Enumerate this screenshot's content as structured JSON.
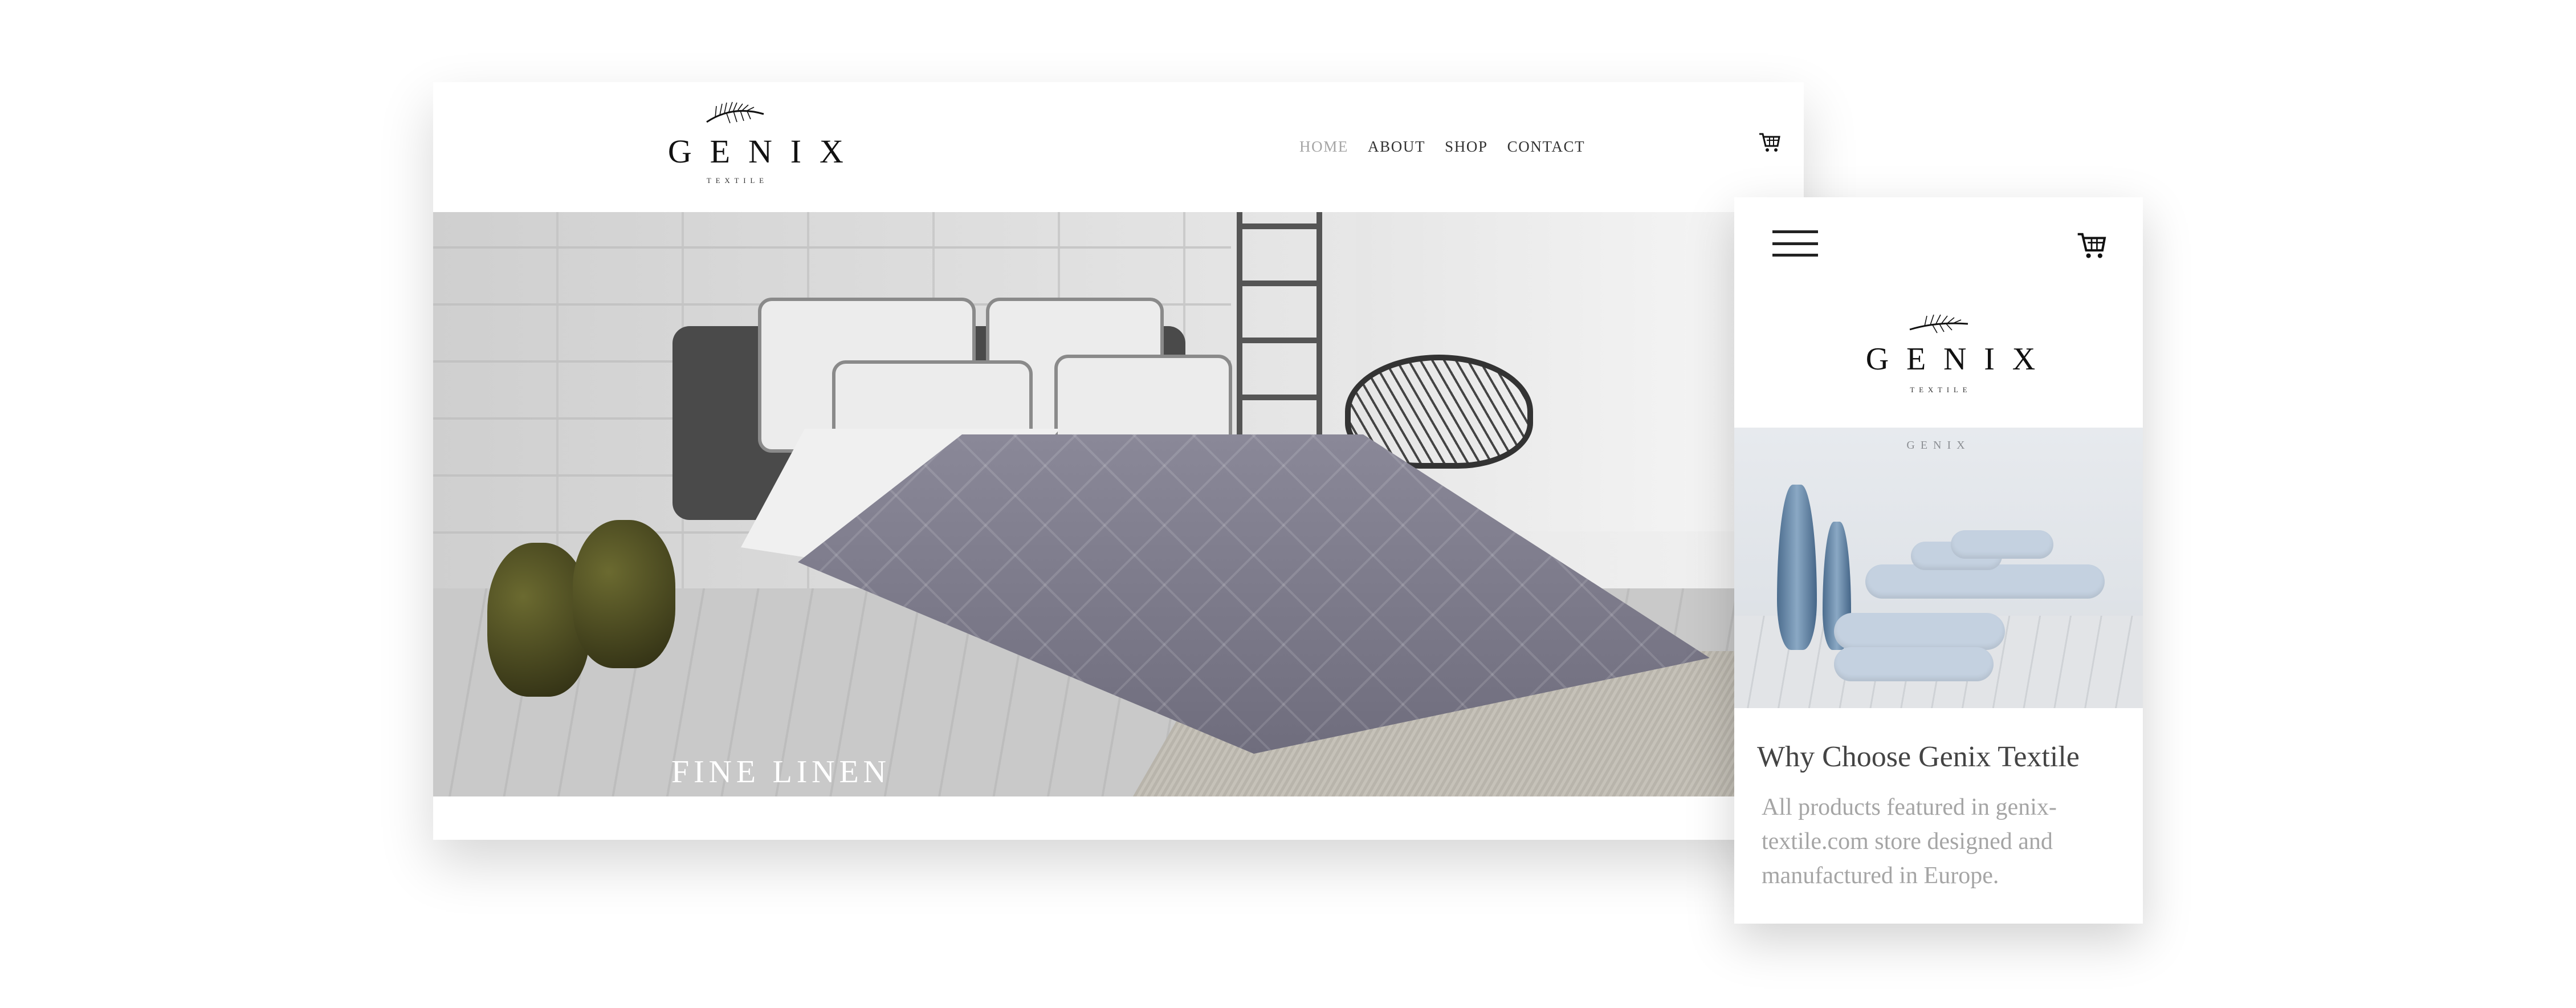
{
  "desktop": {
    "logo": {
      "word": "GENIX",
      "sub": "TEXTILE"
    },
    "nav": [
      {
        "label": "HOME",
        "active": true
      },
      {
        "label": "ABOUT",
        "active": false
      },
      {
        "label": "SHOP",
        "active": false
      },
      {
        "label": "CONTACT",
        "active": false
      }
    ],
    "cart_icon": "shopping-cart-icon",
    "hero_caption": "FINE LINEN"
  },
  "mobile": {
    "menu_icon": "hamburger-menu-icon",
    "cart_icon": "shopping-cart-icon",
    "logo": {
      "word": "GENIX",
      "sub": "TEXTILE"
    },
    "hero_logo": "GENIX",
    "title": "Why Choose Genix Textile",
    "text": "All products featured in genix-textile.com store designed and manufactured in Europe."
  },
  "colors": {
    "nav_active": "#a5a5a5",
    "nav": "#333333",
    "body_text": "#a5a5a5",
    "heading": "#444444"
  }
}
